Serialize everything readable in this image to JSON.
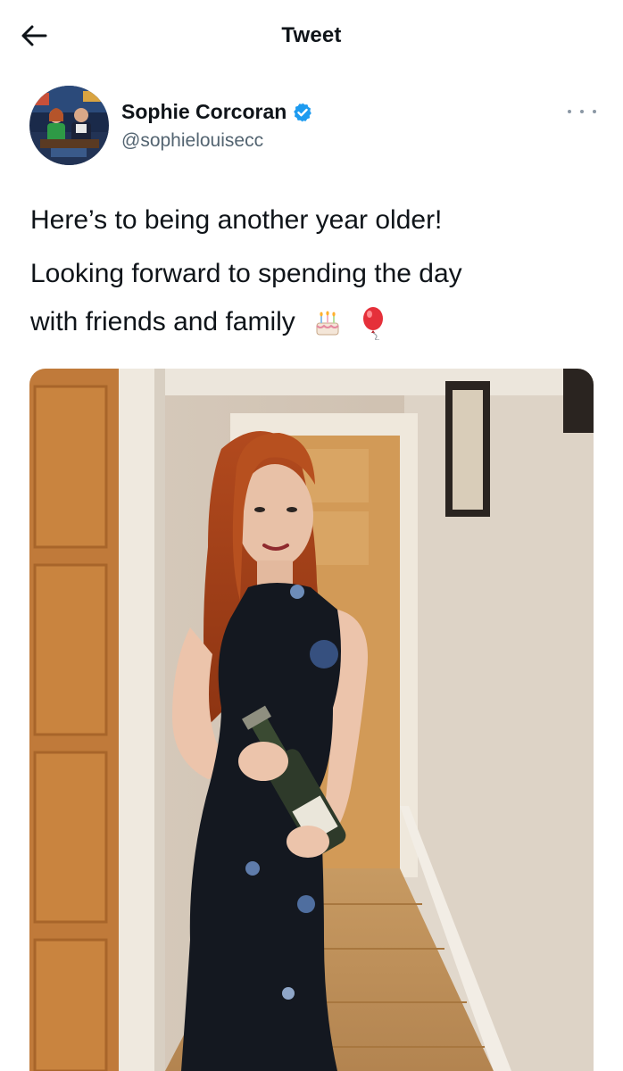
{
  "header": {
    "title": "Tweet",
    "back_icon": "arrow-left-icon"
  },
  "author": {
    "name": "Sophie Corcoran",
    "handle": "@sophielouisecc",
    "verified": true,
    "verified_icon": "verified-badge-icon",
    "verified_color": "#1d9bf0"
  },
  "more_icon": "more-dots-icon",
  "tweet": {
    "line1": "Here’s to being another year older!",
    "line2a": "Looking forward to spending the day",
    "line2b": "with friends and family",
    "emoji": [
      "birthday-cake-icon",
      "balloon-icon"
    ]
  },
  "photo": {
    "semantic": "tweet-photo"
  },
  "colors": {
    "text": "#0f1419",
    "secondary": "#536471",
    "accent": "#1d9bf0"
  }
}
